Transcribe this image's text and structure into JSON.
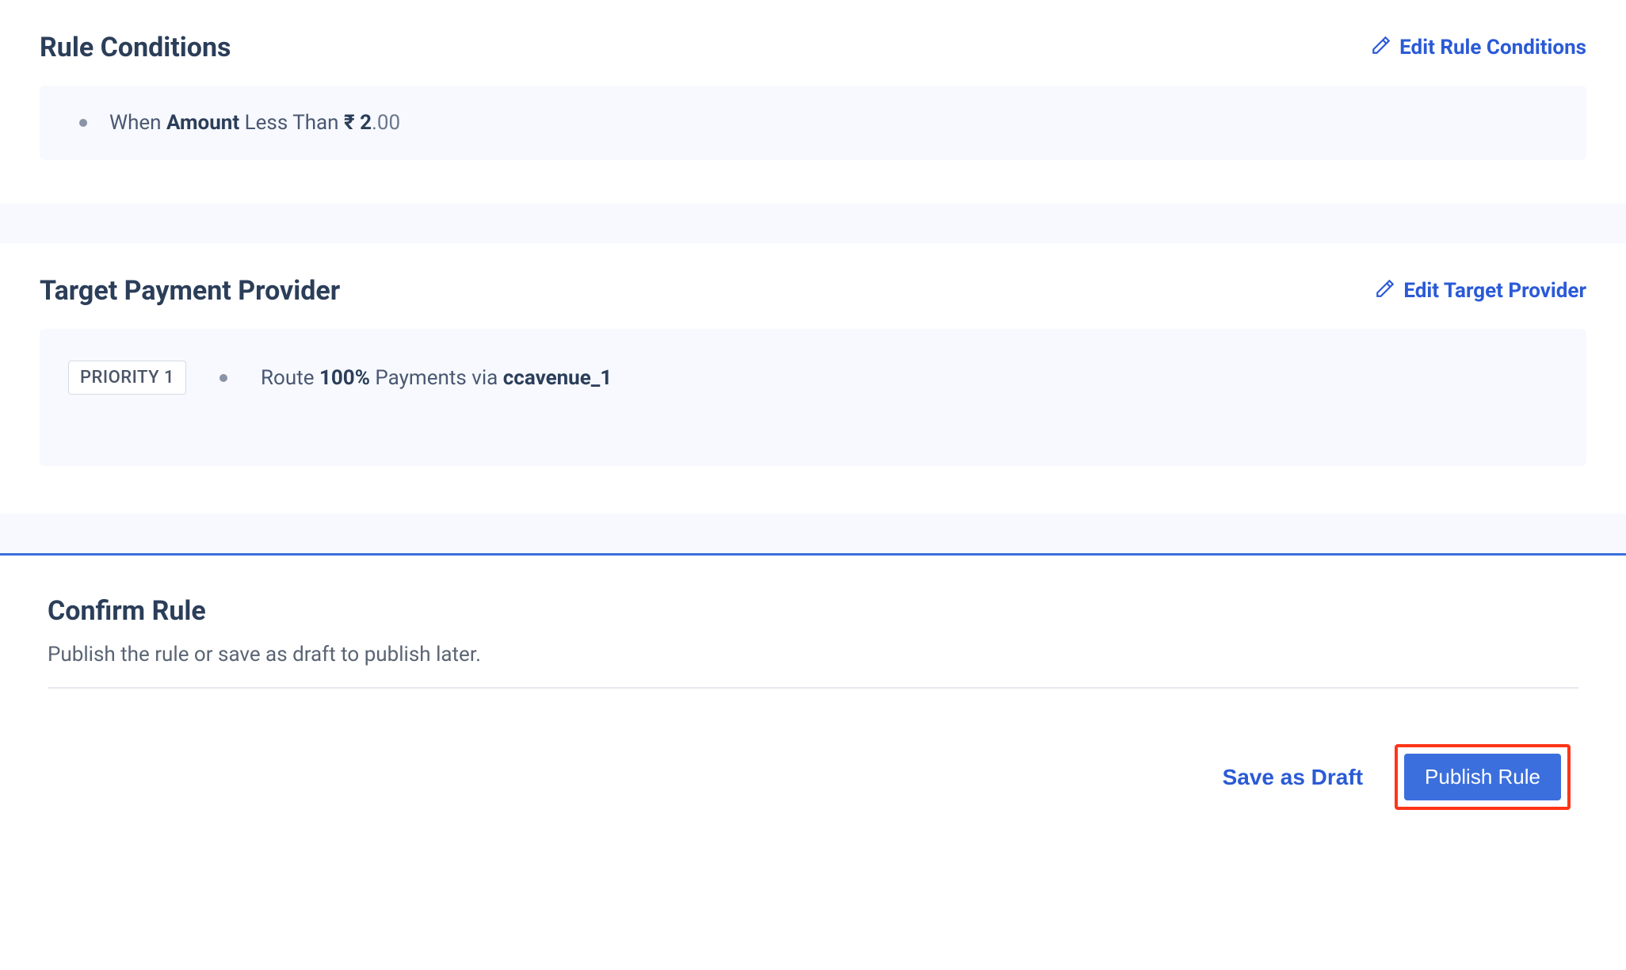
{
  "conditions": {
    "title": "Rule Conditions",
    "edit_label": "Edit Rule Conditions",
    "when": "When ",
    "field": "Amount",
    "operator": " Less Than ",
    "currency": "₹ ",
    "amount_int": "2",
    "amount_dec": ".00"
  },
  "provider": {
    "title": "Target Payment Provider",
    "edit_label": "Edit Target Provider",
    "priority_label": "PRIORITY 1",
    "route_prefix": "Route ",
    "route_percent": "100%",
    "route_middle": " Payments via ",
    "route_target": "ccavenue_1"
  },
  "confirm": {
    "title": "Confirm Rule",
    "description": "Publish the rule or save as draft to publish later.",
    "save_draft_label": "Save as Draft",
    "publish_label": "Publish Rule"
  }
}
